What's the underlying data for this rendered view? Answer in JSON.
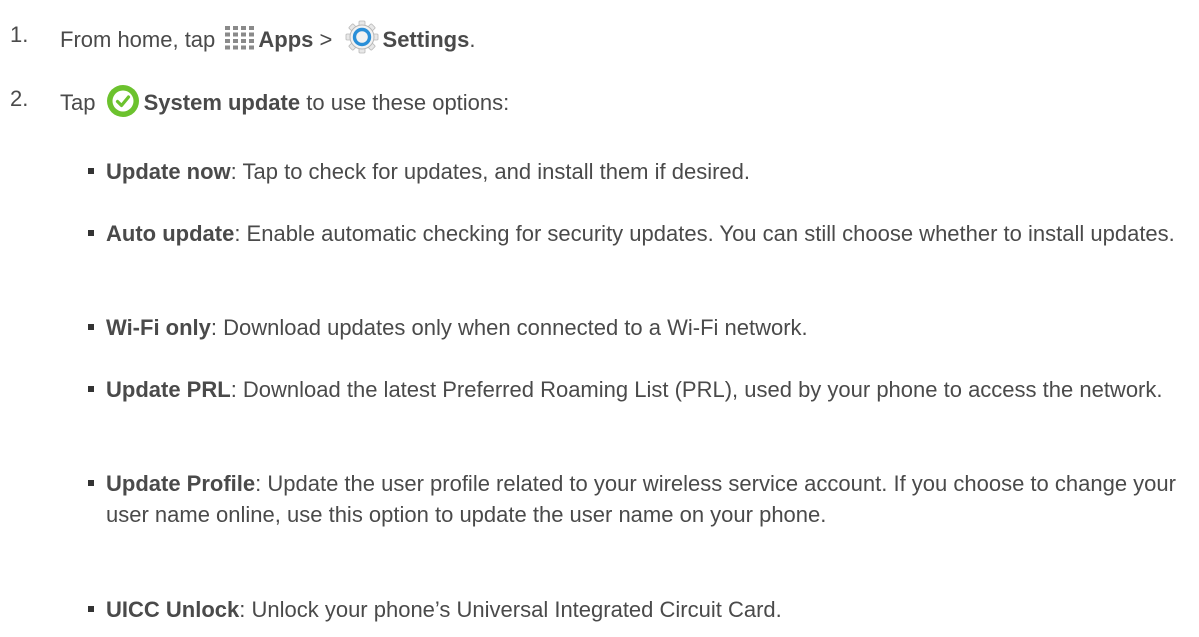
{
  "steps": [
    {
      "number": "1.",
      "prefix": "From home, tap",
      "apps_label": "Apps",
      "separator": ">",
      "settings_label": "Settings",
      "suffix": ".",
      "icons": [
        "apps-grid-icon",
        "settings-gear-icon"
      ]
    },
    {
      "number": "2.",
      "prefix": "Tap",
      "bold_label": "System update",
      "suffix": "to use these options:",
      "icons": [
        "system-update-check-icon"
      ]
    }
  ],
  "options": [
    {
      "term": "Update now",
      "desc": ": Tap to check for updates, and install them if desired."
    },
    {
      "term": "Auto update",
      "desc": ": Enable automatic checking for security updates. You can still choose whether to install updates."
    },
    {
      "term": "Wi-Fi only",
      "desc": ": Download updates only when connected to a Wi-Fi network."
    },
    {
      "term": "Update PRL",
      "desc": ": Download the latest Preferred Roaming List (PRL), used by your phone to access the network."
    },
    {
      "term": "Update Profile",
      "desc": ": Update the user profile related to your wireless service account. If you choose to change your user name online, use this option to update the user name on your phone."
    },
    {
      "term": "UICC Unlock",
      "desc": ": Unlock your phone’s Universal Integrated Circuit Card."
    }
  ],
  "colors": {
    "text": "#4a4a4a",
    "update_icon_green": "#6cc22e",
    "settings_icon_blue": "#2a8fd8",
    "apps_icon_gray": "#8a8a8a"
  }
}
